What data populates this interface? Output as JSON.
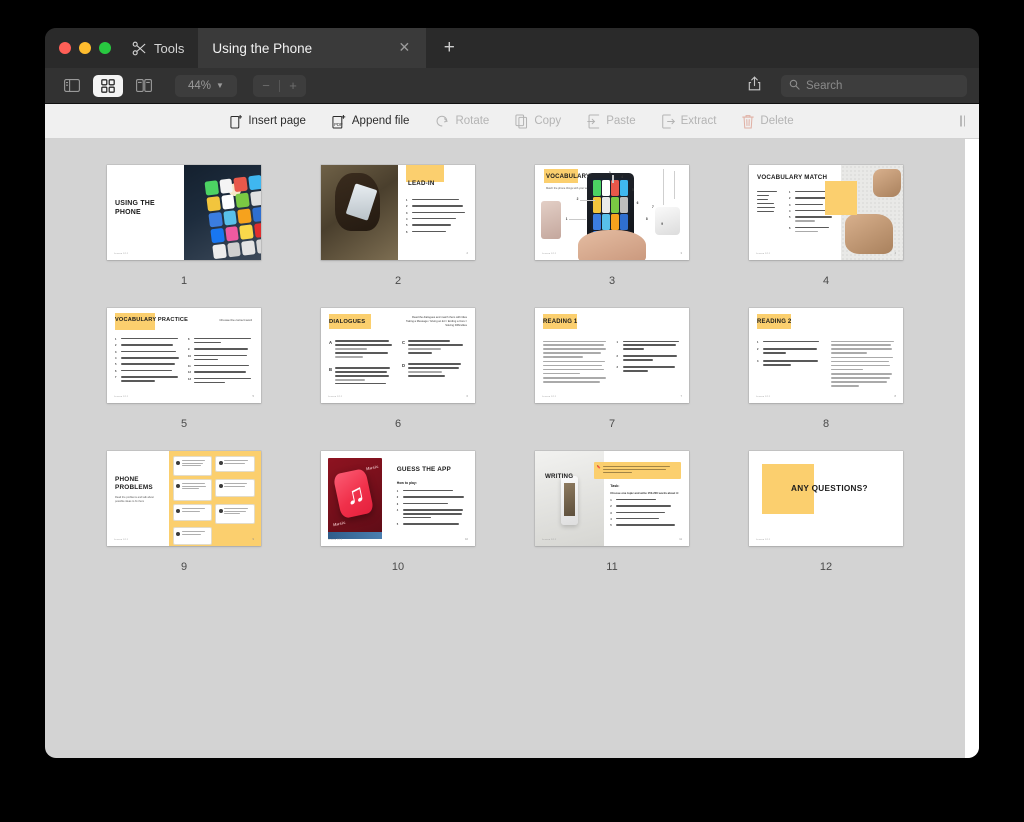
{
  "window": {
    "traffic_lights": [
      "close",
      "minimize",
      "maximize"
    ],
    "tools_label": "Tools",
    "tab_title": "Using the Phone",
    "tab_close_glyph": "✕",
    "new_tab_glyph": "+"
  },
  "toolbar": {
    "view_sidebar_label": "Sidebar view",
    "view_grid_label": "Thumbnail grid view",
    "view_split_label": "Split view",
    "zoom_level": "44%",
    "zoom_chevron": "⌄",
    "zoom_out_glyph": "−",
    "zoom_in_glyph": "+",
    "share_label": "Share",
    "search": {
      "placeholder": "Search",
      "value": ""
    }
  },
  "actionbar": {
    "actions": [
      {
        "label": "Insert page",
        "icon": "insert-page-icon",
        "enabled": true
      },
      {
        "label": "Append file",
        "icon": "append-file-icon",
        "enabled": true
      },
      {
        "label": "Rotate",
        "icon": "rotate-icon",
        "enabled": false
      },
      {
        "label": "Copy",
        "icon": "copy-icon",
        "enabled": false
      },
      {
        "label": "Paste",
        "icon": "paste-icon",
        "enabled": false
      },
      {
        "label": "Extract",
        "icon": "extract-icon",
        "enabled": false
      },
      {
        "label": "Delete",
        "icon": "trash-icon",
        "enabled": false
      }
    ],
    "grip_label": "panel-resize-grip"
  },
  "document": {
    "accent_yellow": "#fbcf6e",
    "page_background": "#d3d3d3",
    "total_pages": 12,
    "pages": [
      {
        "number": "1",
        "layout": "title-photo-right",
        "title": "USING THE PHONE",
        "footer": "Lesson 1/12",
        "photo": "phone-home-screen-photo"
      },
      {
        "number": "2",
        "layout": "photo-left-list-right",
        "title": "LEAD-IN",
        "photo": "hands-holding-phone-photo",
        "item_count": 6,
        "page_label": "2"
      },
      {
        "number": "3",
        "layout": "labelled-diagram",
        "title": "VOCABULARY",
        "subtitle": "Match the phone things with your words",
        "labels": [
          "1",
          "2",
          "3",
          "4",
          "5",
          "6",
          "7",
          "8",
          "9"
        ],
        "page_label": "3"
      },
      {
        "number": "4",
        "layout": "word-match-photo-right",
        "title": "VOCABULARY MATCH",
        "words": [
          "take a selfie",
          "text",
          "call",
          "answer",
          "hang up",
          "ringtone"
        ],
        "item_count": 6,
        "photo": "hands-with-phone-dotted-photo",
        "page_label": "4"
      },
      {
        "number": "5",
        "layout": "two-column-exercise",
        "title": "VOCABULARY PRACTICE",
        "instruction": "Choose the correct word",
        "left_count": 7,
        "right_count": 7,
        "page_label": "5"
      },
      {
        "number": "6",
        "layout": "dialogues-quad",
        "title": "DIALOGUES",
        "instruction": "Read the dialogues and match them with titles",
        "instruction2": "Taking a Message / Giving an Err / Ending a Conv / Solving Difficulties",
        "sections": [
          "A",
          "B",
          "C",
          "D"
        ],
        "page_label": "6"
      },
      {
        "number": "7",
        "layout": "reading-text-left-questions-right",
        "title": "READING 1",
        "question_count": 3,
        "page_label": "7"
      },
      {
        "number": "8",
        "layout": "reading-questions-left-text-right",
        "title": "READING 2",
        "question_count": 3,
        "page_label": "8"
      },
      {
        "number": "9",
        "layout": "problem-cards-on-yellow",
        "title": "PHONE PROBLEMS",
        "subtitle": "Read the problems and talk about possible ideas to fix them",
        "card_count": 7,
        "page_label": "9"
      },
      {
        "number": "10",
        "layout": "photo-left-instructions-right",
        "title": "GUESS THE APP",
        "subtitle": "How to play:",
        "item_count": 5,
        "photo": "apple-music-app-icon-photo",
        "page_label": "10"
      },
      {
        "number": "11",
        "layout": "photo-left-task-right",
        "title": "WRITING",
        "callout": "Language: write two or three sentences about your experience and what it made you feel",
        "task_label": "Task:",
        "task_question": "Choose one topic and write 150-200 words about it:",
        "item_count": 5,
        "photo": "phone-on-grey-podium-photo",
        "page_label": "11"
      },
      {
        "number": "12",
        "layout": "closing",
        "title": "ANY QUESTIONS?",
        "footer": "Lesson 1/12",
        "page_label": "12"
      }
    ]
  }
}
